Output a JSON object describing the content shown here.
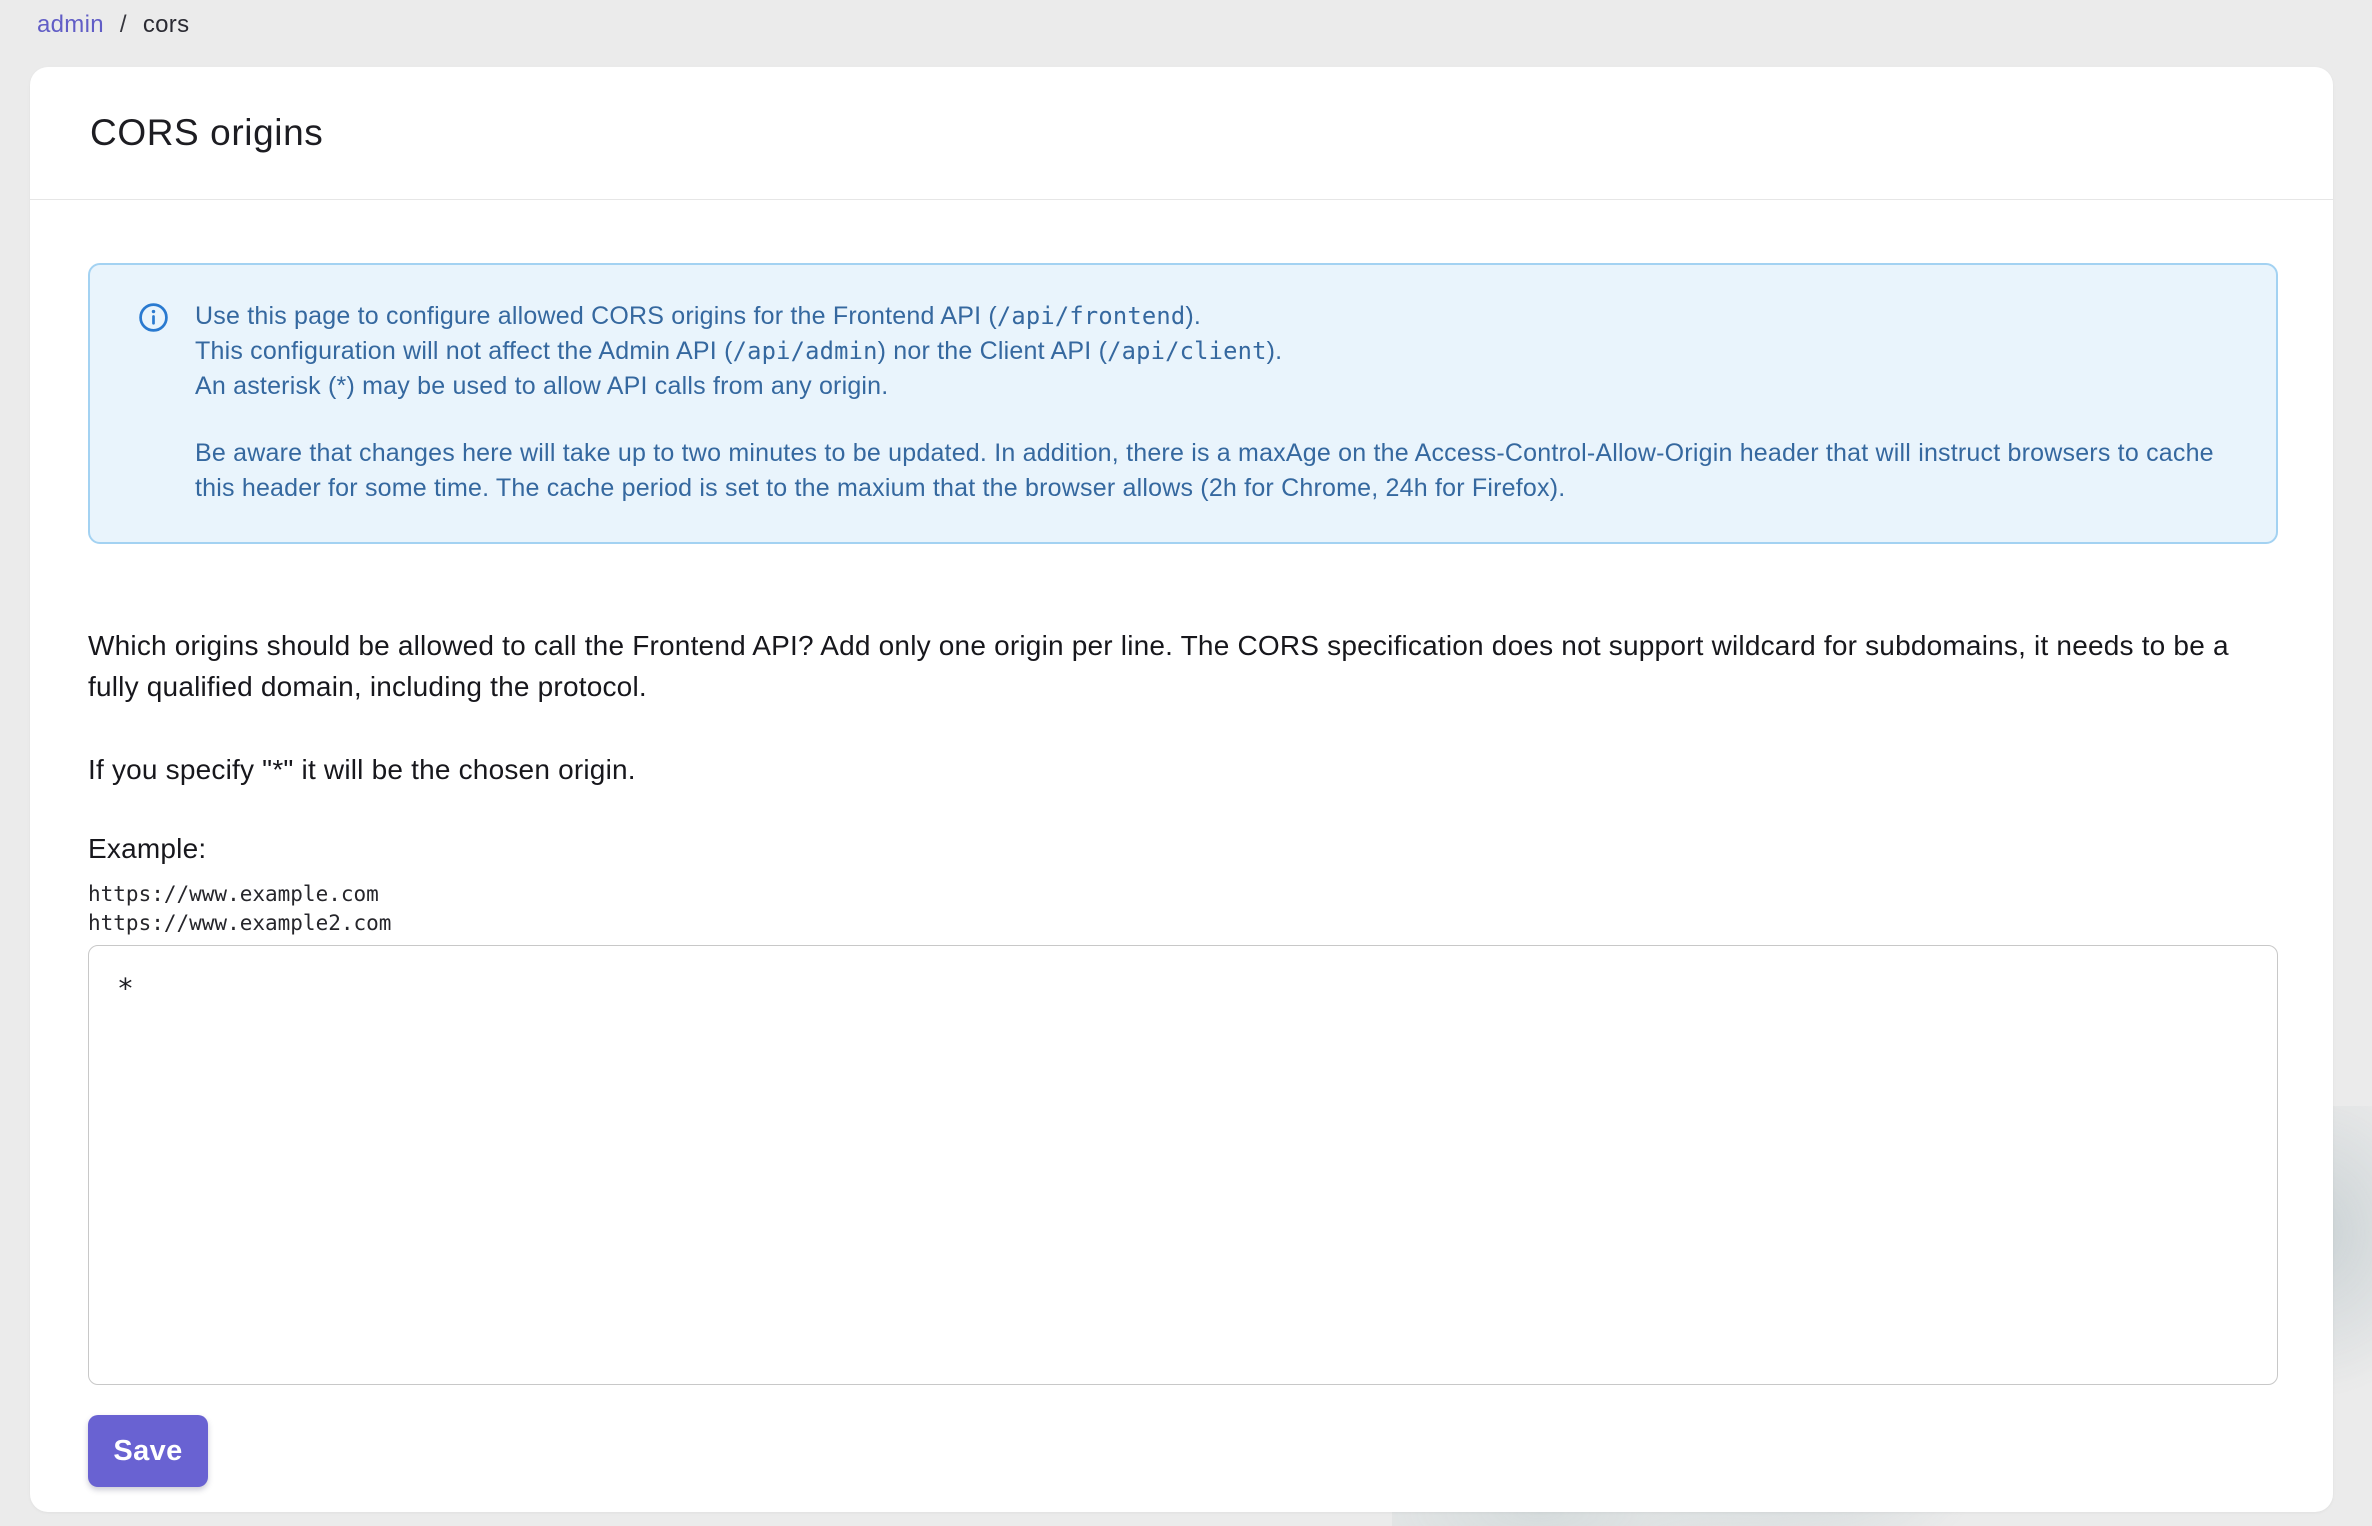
{
  "breadcrumb": {
    "link": "admin",
    "separator": "/",
    "current": "cors"
  },
  "page": {
    "title": "CORS origins"
  },
  "info_box": {
    "icon": "info-icon",
    "paragraph1": [
      [
        {
          "text": "Use this page to configure allowed CORS origins for the Frontend API ("
        },
        {
          "text": "/api/frontend",
          "mono": true
        },
        {
          "text": ")."
        }
      ],
      [
        {
          "text": "This configuration will not affect the Admin API ("
        },
        {
          "text": "/api/admin",
          "mono": true
        },
        {
          "text": ") nor the Client API ("
        },
        {
          "text": "/api/client",
          "mono": true
        },
        {
          "text": ")."
        }
      ],
      [
        {
          "text": "An asterisk (*) may be used to allow API calls from any origin."
        }
      ]
    ],
    "paragraph2": "Be aware that changes here will take up to two minutes to be updated. In addition, there is a maxAge on the Access-Control-Allow-Origin header that will instruct browsers to cache this header for some time. The cache period is set to the maxium that the browser allows (2h for Chrome, 24h for Firefox)."
  },
  "content": {
    "description": "Which origins should be allowed to call the Frontend API? Add only one origin per line. The CORS specification does not support wildcard for subdomains, it needs to be a fully qualified domain, including the protocol.",
    "wildcard_note": "If you specify \"*\" it will be the chosen origin.",
    "example_label": "Example:",
    "example_origins": [
      "https://www.example.com",
      "https://www.example2.com"
    ],
    "textarea_value": "*",
    "save_label": "Save"
  },
  "colors": {
    "accent_purple": "#615dc6",
    "button_purple": "#6962d2",
    "info_text_blue": "#35689f",
    "info_bg": "#e9f4fc",
    "info_border": "#a3d2f2",
    "info_icon_blue": "#2a7ad0",
    "page_bg": "#ebebeb"
  }
}
